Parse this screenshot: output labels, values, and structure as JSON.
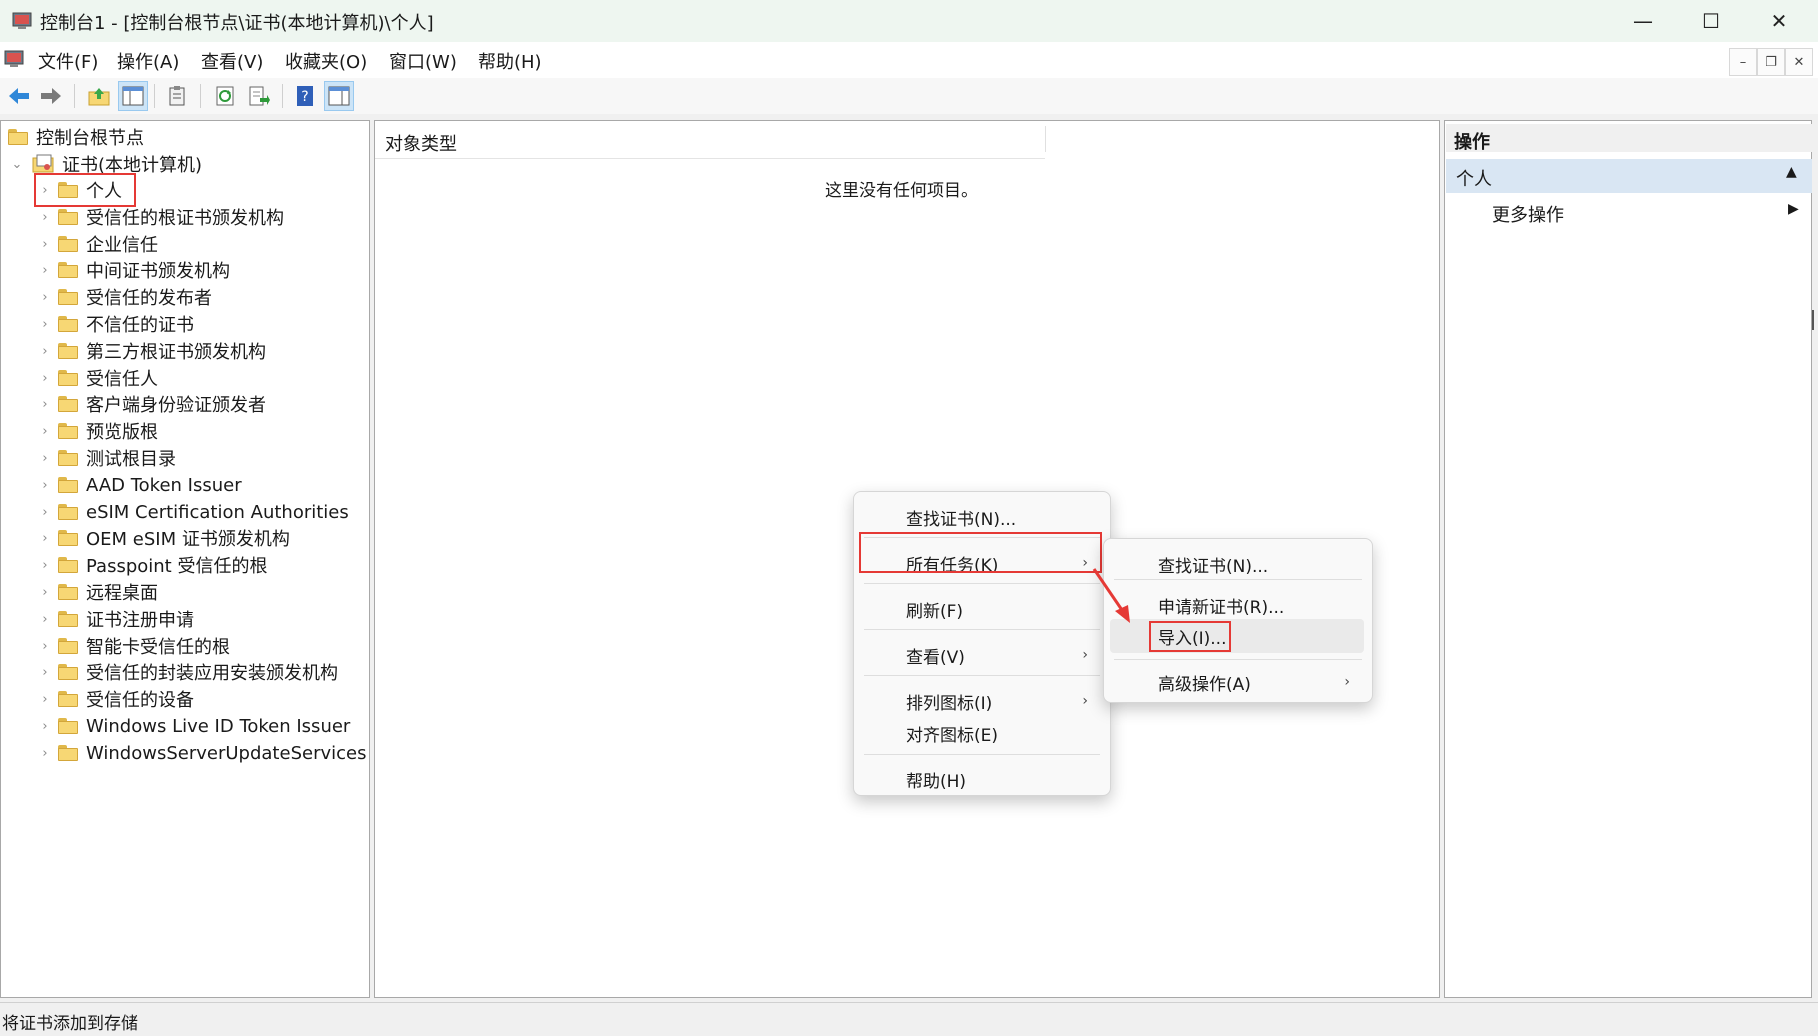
{
  "window": {
    "title": "控制台1 - [控制台根节点\\证书(本地计算机)\\个人]",
    "minimize": "—",
    "maximize": "☐",
    "close": "✕"
  },
  "menubar": {
    "items": [
      "文件(F)",
      "操作(A)",
      "查看(V)",
      "收藏夹(O)",
      "窗口(W)",
      "帮助(H)"
    ]
  },
  "tree": {
    "root": "控制台根节点",
    "certs_node": "证书(本地计算机)",
    "children": [
      "个人",
      "受信任的根证书颁发机构",
      "企业信任",
      "中间证书颁发机构",
      "受信任的发布者",
      "不信任的证书",
      "第三方根证书颁发机构",
      "受信任人",
      "客户端身份验证颁发者",
      "预览版根",
      "测试根目录",
      "AAD Token Issuer",
      "eSIM Certification Authorities",
      "OEM eSIM 证书颁发机构",
      "Passpoint 受信任的根",
      "远程桌面",
      "证书注册申请",
      "智能卡受信任的根",
      "受信任的封装应用安装颁发机构",
      "受信任的设备",
      "Windows Live ID Token Issuer",
      "WindowsServerUpdateServices"
    ]
  },
  "center": {
    "column_header": "对象类型",
    "empty_text": "这里没有任何项目。"
  },
  "actions": {
    "header": "操作",
    "section": "个人",
    "more": "更多操作"
  },
  "context_menu": {
    "items": [
      "查找证书(N)...",
      "所有任务(K)",
      "刷新(F)",
      "查看(V)",
      "排列图标(I)",
      "对齐图标(E)",
      "帮助(H)"
    ]
  },
  "submenu": {
    "items": [
      "查找证书(N)...",
      "申请新证书(R)...",
      "导入(I)...",
      "高级操作(A)"
    ]
  },
  "status": {
    "text": "将证书添加到存储"
  },
  "colors": {
    "highlight_box": "#e53935",
    "selection": "#d9e6f3",
    "titlebar": "#eef6f0"
  }
}
